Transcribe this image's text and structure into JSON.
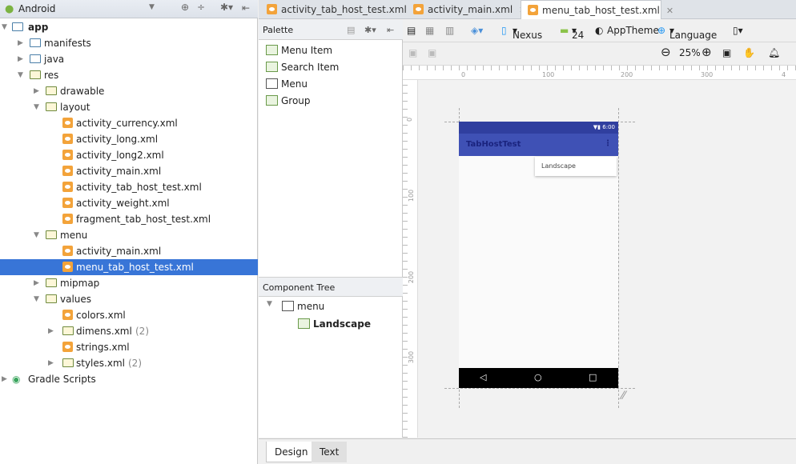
{
  "project_panel": {
    "view_selector": "Android",
    "tree": [
      {
        "label": "app",
        "level": 0,
        "expanded": true,
        "bold": true,
        "icon": "module-folder-icon"
      },
      {
        "label": "manifests",
        "level": 1,
        "expanded": false,
        "icon": "folder-icon"
      },
      {
        "label": "java",
        "level": 1,
        "expanded": false,
        "icon": "folder-icon"
      },
      {
        "label": "res",
        "level": 1,
        "expanded": true,
        "icon": "res-folder-icon"
      },
      {
        "label": "drawable",
        "level": 2,
        "expanded": false,
        "icon": "package-folder-icon"
      },
      {
        "label": "layout",
        "level": 2,
        "expanded": true,
        "icon": "package-folder-icon"
      },
      {
        "label": "activity_currency.xml",
        "level": 3,
        "icon": "xml-file-icon"
      },
      {
        "label": "activity_long.xml",
        "level": 3,
        "icon": "xml-file-icon"
      },
      {
        "label": "activity_long2.xml",
        "level": 3,
        "icon": "xml-file-icon"
      },
      {
        "label": "activity_main.xml",
        "level": 3,
        "icon": "xml-file-icon"
      },
      {
        "label": "activity_tab_host_test.xml",
        "level": 3,
        "icon": "xml-file-icon"
      },
      {
        "label": "activity_weight.xml",
        "level": 3,
        "icon": "xml-file-icon"
      },
      {
        "label": "fragment_tab_host_test.xml",
        "level": 3,
        "icon": "xml-file-icon"
      },
      {
        "label": "menu",
        "level": 2,
        "expanded": true,
        "icon": "package-folder-icon"
      },
      {
        "label": "activity_main.xml",
        "level": 3,
        "icon": "xml-file-icon"
      },
      {
        "label": "menu_tab_host_test.xml",
        "level": 3,
        "icon": "xml-file-icon",
        "selected": true
      },
      {
        "label": "mipmap",
        "level": 2,
        "expanded": false,
        "icon": "package-folder-icon"
      },
      {
        "label": "values",
        "level": 2,
        "expanded": true,
        "icon": "package-folder-icon"
      },
      {
        "label": "colors.xml",
        "level": 3,
        "icon": "xml-file-icon"
      },
      {
        "label": "dimens.xml",
        "level": 3,
        "expanded": false,
        "count": "(2)",
        "icon": "package-folder-icon"
      },
      {
        "label": "strings.xml",
        "level": 3,
        "icon": "xml-file-icon"
      },
      {
        "label": "styles.xml",
        "level": 3,
        "expanded": false,
        "count": "(2)",
        "icon": "package-folder-icon"
      },
      {
        "label": "Gradle Scripts",
        "level": 0,
        "expanded": false,
        "icon": "gradle-icon"
      }
    ]
  },
  "editor_tabs": [
    {
      "label": "activity_tab_host_test.xml",
      "active": false
    },
    {
      "label": "activity_main.xml",
      "active": false
    },
    {
      "label": "menu_tab_host_test.xml",
      "active": true
    }
  ],
  "palette": {
    "title": "Palette",
    "items": [
      "Menu Item",
      "Search Item",
      "Menu",
      "Group"
    ]
  },
  "component_tree": {
    "title": "Component Tree",
    "root": "menu",
    "child": "Landscape"
  },
  "toolbar": {
    "device": "Nexus 4",
    "api": "24",
    "theme": "AppTheme",
    "language": "Language",
    "zoom": "25%"
  },
  "ruler": {
    "h": [
      "0",
      "100",
      "200",
      "300",
      "4"
    ],
    "v": [
      "0",
      "100",
      "200",
      "300"
    ]
  },
  "preview": {
    "status_time": "6:00",
    "app_title": "TabHostTest",
    "menu_item": "Landscape",
    "accent": "#3f51b5",
    "status_color": "#303f9f"
  },
  "bottom_tabs": [
    "Design",
    "Text"
  ]
}
